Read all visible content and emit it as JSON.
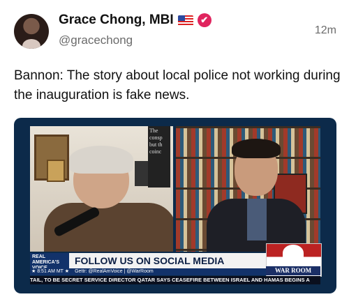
{
  "tweet": {
    "author_name": "Grace Chong, MBI",
    "handle": "@gracechong",
    "time": "12m",
    "text": "Bannon: The story about local police not working during the inauguration is fake news.",
    "verified_glyph": "✔"
  },
  "media": {
    "left_sign": "The consp but th coinc",
    "banner_logo": "REAL AMERICA'S VOICE",
    "banner_headline": "FOLLOW US ON SOCIAL MEDIA",
    "banner_time": "★ 8:51 AM MT ★",
    "banner_handles": "Gettr: @RealAmVoice | @WarRoom",
    "warroom_label": "WAR ROOM",
    "ticker": "TAIL, TO BE SECRET SERVICE DIRECTOR    QATAR SAYS CEASEFIRE BETWEEN ISRAEL AND HAMAS BEGINS A"
  },
  "colors": {
    "verified": "#e0245e",
    "banner": "#12326a",
    "frame_bg": "#0c2a4a"
  }
}
